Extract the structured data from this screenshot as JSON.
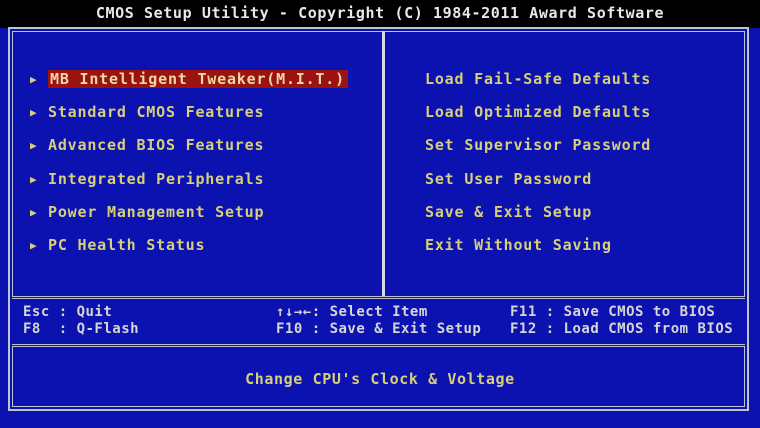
{
  "title": "CMOS Setup Utility - Copyright (C) 1984-2011 Award Software",
  "left_menu": [
    {
      "label": "MB Intelligent Tweaker(M.I.T.)",
      "selected": true,
      "icon": "arrow-right-icon"
    },
    {
      "label": "Standard CMOS Features",
      "icon": "arrow-right-icon"
    },
    {
      "label": "Advanced BIOS Features",
      "icon": "arrow-right-icon"
    },
    {
      "label": "Integrated Peripherals",
      "icon": "arrow-right-icon"
    },
    {
      "label": "Power Management Setup",
      "icon": "arrow-right-icon"
    },
    {
      "label": "PC Health Status",
      "icon": "arrow-right-icon"
    }
  ],
  "right_menu": [
    {
      "label": "Load Fail-Safe Defaults"
    },
    {
      "label": "Load Optimized Defaults"
    },
    {
      "label": "Set Supervisor Password"
    },
    {
      "label": "Set User Password"
    },
    {
      "label": "Save & Exit Setup"
    },
    {
      "label": "Exit Without Saving"
    }
  ],
  "help": {
    "esc": "Esc : Quit",
    "f8": "F8  : Q-Flash",
    "select": "↑↓→←: Select Item",
    "f10": "F10 : Save & Exit Setup",
    "f11": "F11 : Save CMOS to BIOS",
    "f12": "F12 : Load CMOS from BIOS"
  },
  "status": "Change CPU's Clock & Voltage",
  "colors": {
    "background": "#0b12b0",
    "menu_text": "#d8cf7a",
    "highlight": "#9a1212",
    "help_text": "#d6d6d6",
    "title_bar": "#000000"
  }
}
